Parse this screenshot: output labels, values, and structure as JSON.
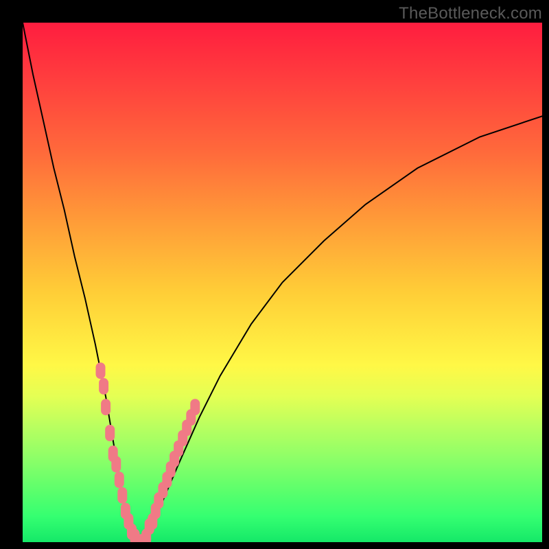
{
  "watermark": "TheBottleneck.com",
  "chart_data": {
    "type": "line",
    "title": "",
    "xlabel": "",
    "ylabel": "",
    "xlim": [
      0,
      100
    ],
    "ylim": [
      0,
      100
    ],
    "series": [
      {
        "name": "bottleneck-curve",
        "x": [
          0,
          2,
          4,
          6,
          8,
          10,
          12,
          14,
          16,
          18,
          19,
          20,
          21,
          22,
          23,
          24,
          25,
          27,
          30,
          34,
          38,
          44,
          50,
          58,
          66,
          76,
          88,
          100
        ],
        "y": [
          100,
          90,
          81,
          72,
          64,
          55,
          47,
          38,
          28,
          16,
          10,
          5,
          2,
          0,
          0,
          1,
          3,
          8,
          15,
          24,
          32,
          42,
          50,
          58,
          65,
          72,
          78,
          82
        ]
      }
    ],
    "highlight_points": {
      "name": "marker-cluster",
      "color": "#f07a86",
      "points": [
        {
          "x": 15.0,
          "y": 33
        },
        {
          "x": 15.6,
          "y": 30
        },
        {
          "x": 16.0,
          "y": 26
        },
        {
          "x": 16.8,
          "y": 21
        },
        {
          "x": 17.4,
          "y": 17
        },
        {
          "x": 18.0,
          "y": 15
        },
        {
          "x": 18.6,
          "y": 12
        },
        {
          "x": 19.2,
          "y": 9
        },
        {
          "x": 19.8,
          "y": 6
        },
        {
          "x": 20.4,
          "y": 4
        },
        {
          "x": 21.0,
          "y": 2
        },
        {
          "x": 21.6,
          "y": 1
        },
        {
          "x": 22.2,
          "y": 0
        },
        {
          "x": 23.0,
          "y": 0
        },
        {
          "x": 23.8,
          "y": 1
        },
        {
          "x": 24.4,
          "y": 3
        },
        {
          "x": 25.0,
          "y": 4
        },
        {
          "x": 25.6,
          "y": 6
        },
        {
          "x": 26.2,
          "y": 8
        },
        {
          "x": 27.0,
          "y": 10
        },
        {
          "x": 27.8,
          "y": 12
        },
        {
          "x": 28.5,
          "y": 14
        },
        {
          "x": 29.2,
          "y": 16
        },
        {
          "x": 30.0,
          "y": 18
        },
        {
          "x": 30.8,
          "y": 20
        },
        {
          "x": 31.6,
          "y": 22
        },
        {
          "x": 32.4,
          "y": 24
        },
        {
          "x": 33.2,
          "y": 26
        }
      ]
    }
  }
}
